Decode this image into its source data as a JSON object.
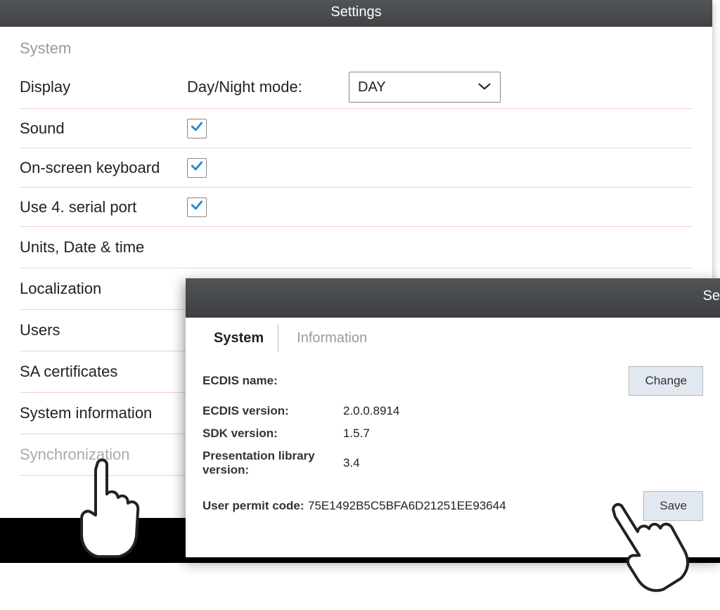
{
  "main": {
    "title": "Settings",
    "section": "System",
    "display": {
      "label": "Display",
      "mode_label": "Day/Night mode:",
      "mode_value": "DAY"
    },
    "sound_label": "Sound",
    "keyboard_label": "On-screen keyboard",
    "serial_label": "Use 4. serial port",
    "nav": {
      "units": "Units, Date & time",
      "localization": "Localization",
      "users": "Users",
      "sa": "SA certificates",
      "sysinfo": "System information",
      "sync": "Synchronization"
    }
  },
  "sub": {
    "title_partial": "Se",
    "tabs": {
      "system": "System",
      "information": "Information"
    },
    "rows": {
      "ecdis_name_label": "ECDIS name:",
      "change_btn": "Change",
      "ecdis_ver_label": "ECDIS version:",
      "ecdis_ver": "2.0.0.8914",
      "sdk_label": "SDK version:",
      "sdk": "1.5.7",
      "preslib_label": "Presentation library version:",
      "preslib": "3.4",
      "permit_label": "User permit code:",
      "permit": "75E1492B5C5BFA6D21251EE93644",
      "save_btn": "Save"
    }
  }
}
